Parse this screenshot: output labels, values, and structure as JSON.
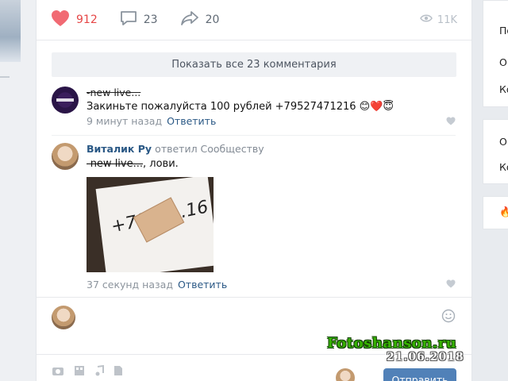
{
  "post": {
    "likes": "912",
    "comments": "23",
    "shares": "20",
    "views": "11K",
    "show_all": "Показать все 23 комментария"
  },
  "comments": [
    {
      "author": "-new live...",
      "text": "Закиньте пожалуйста 100 рублей +79527471216 😊❤️😇",
      "time": "9 минут назад",
      "reply": "Ответить"
    },
    {
      "author": "Виталик Ру",
      "replied_to": "ответил Сообществу",
      "text_mention": "-new live...",
      "text_rest": ", лови.",
      "photo_text": "+7952…16",
      "time": "37 секунд назад",
      "reply": "Ответить"
    }
  ],
  "composer": {
    "placeholder": "",
    "send_label": "Отправить"
  },
  "right_column": {
    "box1": [
      "По",
      "О",
      "Ко"
    ],
    "box2": [
      "О",
      "Ко"
    ],
    "box3": [
      "🔥"
    ]
  },
  "watermark": {
    "site": "Fotoshanson.ru",
    "date": "21.06.2018"
  },
  "icons": {
    "like": "heart-icon",
    "comment": "comment-icon",
    "share": "share-arrow-icon",
    "views": "eye-icon",
    "emoji": "smile-icon"
  },
  "colors": {
    "like": "#e64646",
    "link": "#2a5885",
    "button": "#5181b8",
    "watermark": "#36b000"
  }
}
